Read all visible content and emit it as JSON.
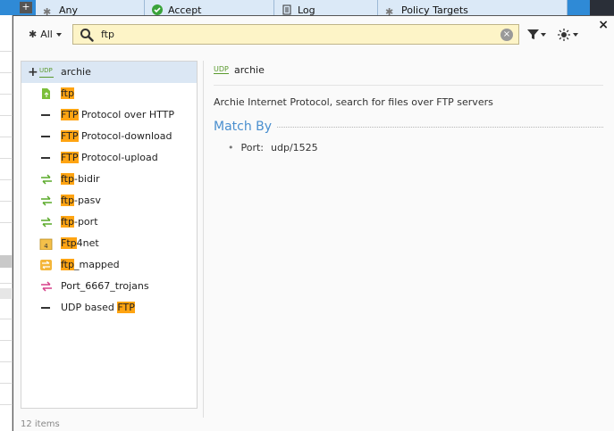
{
  "background": {
    "columns": [
      {
        "label": "Any",
        "icon": "asterisk-icon"
      },
      {
        "label": "Accept",
        "icon": "accept-icon"
      },
      {
        "label": "Log",
        "icon": "log-icon"
      },
      {
        "label": "Policy Targets",
        "icon": "asterisk-icon"
      }
    ]
  },
  "toolbar": {
    "filter_label": "All",
    "search_value": "ftp",
    "search_placeholder": "Search",
    "close_label": "×",
    "clear_label": "×"
  },
  "list": {
    "items": [
      {
        "pre": "",
        "hl": "",
        "post": "archie",
        "icon": "udp-badge-icon",
        "badge": "UDP",
        "selected": true
      },
      {
        "pre": "",
        "hl": "ftp",
        "post": "",
        "icon": "green-doc-icon"
      },
      {
        "pre": "",
        "hl": "FTP",
        "post": " Protocol over HTTP",
        "icon": "dash-icon"
      },
      {
        "pre": "",
        "hl": "FTP",
        "post": " Protocol-download",
        "icon": "dash-icon"
      },
      {
        "pre": "",
        "hl": "FTP",
        "post": " Protocol-upload",
        "icon": "dash-icon"
      },
      {
        "pre": "",
        "hl": "ftp",
        "post": "-bidir",
        "icon": "green-arrows-icon"
      },
      {
        "pre": "",
        "hl": "ftp",
        "post": "-pasv",
        "icon": "green-arrows-icon"
      },
      {
        "pre": "",
        "hl": "ftp",
        "post": "-port",
        "icon": "green-arrows-icon"
      },
      {
        "pre": "",
        "hl": "Ftp",
        "post": "4net",
        "icon": "folder-4-icon"
      },
      {
        "pre": "",
        "hl": "ftp",
        "post": "_mapped",
        "icon": "mapped-icon"
      },
      {
        "pre": "",
        "hl": "",
        "post": "Port_6667_trojans",
        "icon": "pink-arrows-icon"
      },
      {
        "pre": "UDP based ",
        "hl": "FTP",
        "post": "",
        "icon": "dash-icon"
      }
    ],
    "count_label": "12 items"
  },
  "detail": {
    "badge": "UDP",
    "name": "archie",
    "description": "Archie Internet Protocol, search for files over FTP servers",
    "match_by_title": "Match By",
    "port_label": "Port:",
    "port_value": "udp/1525"
  },
  "colors": {
    "accent": "#4a8fcf",
    "highlight": "#ffa412",
    "search_bg": "#fdf4c7",
    "selected_row": "#dbe7f4",
    "header_blue": "#2f8ad6"
  }
}
